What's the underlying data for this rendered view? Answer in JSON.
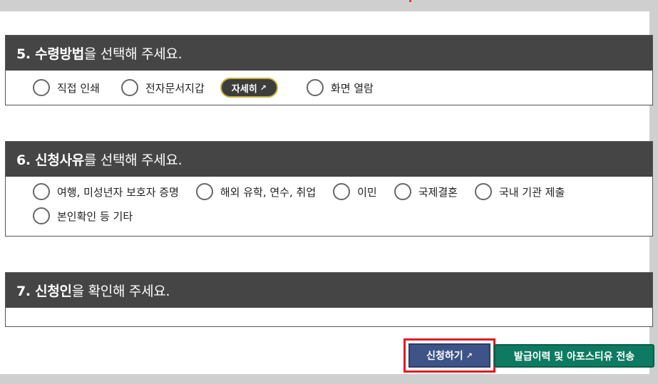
{
  "sections": [
    {
      "number_title_bold": "5. 수령방법",
      "title_rest": "을 선택해 주세요.",
      "options": [
        {
          "label": "직접 인쇄"
        },
        {
          "label": "전자문서지갑"
        },
        {
          "label": "화면 열람"
        }
      ],
      "detail_button": "자세히"
    },
    {
      "number_title_bold": "6. 신청사유",
      "title_rest": "를 선택해 주세요.",
      "options": [
        {
          "label": "여행, 미성년자 보호자 증명"
        },
        {
          "label": "해외 유학, 연수, 취업"
        },
        {
          "label": "이민"
        },
        {
          "label": "국제결혼"
        },
        {
          "label": "국내 기관 제출"
        },
        {
          "label": "본인확인 등 기타"
        }
      ]
    },
    {
      "number_title_bold": "7. 신청인",
      "title_rest": "을 확인해 주세요."
    }
  ],
  "buttons": {
    "apply": "신청하기",
    "history": "발급이력 및 아포스티유 전송"
  },
  "icons": {
    "external": "external-link-icon"
  }
}
